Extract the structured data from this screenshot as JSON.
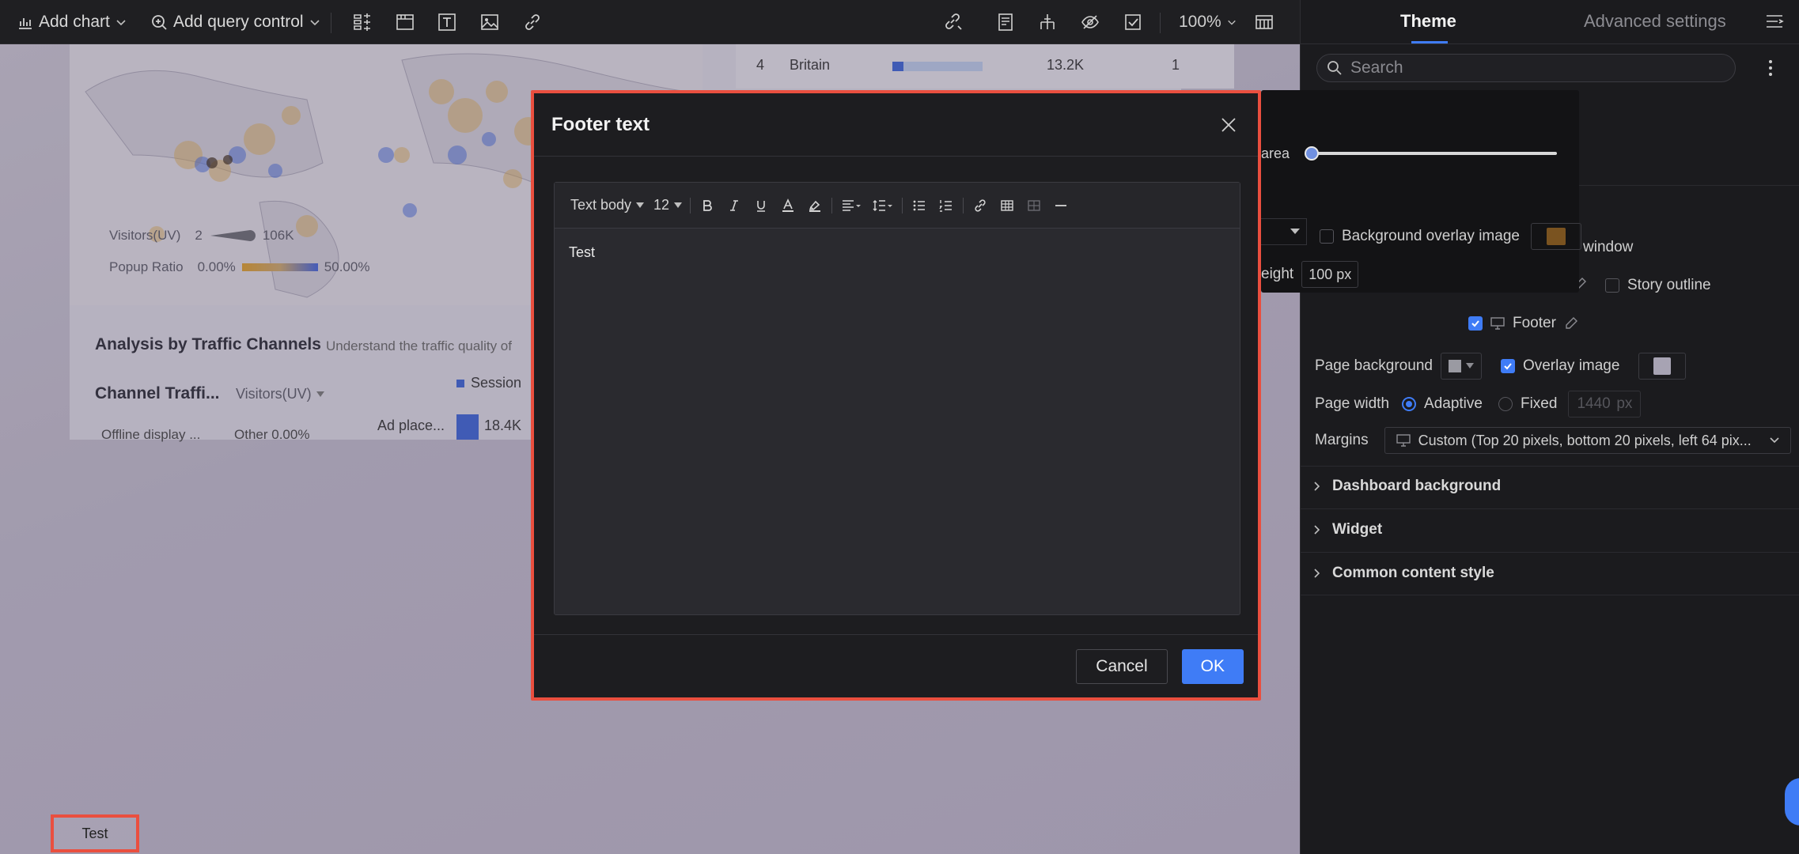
{
  "toolbar": {
    "add_chart": "Add chart",
    "add_query_control": "Add query control",
    "zoom": "100%"
  },
  "dashboard": {
    "ranking_row": {
      "rank": "4",
      "country": "Britain",
      "value": "13.2K",
      "trailing": "1",
      "share": 0.12
    },
    "map_legend": {
      "visitors_label": "Visitors(UV)",
      "visitors_min": "2",
      "visitors_max": "106K",
      "popup_label": "Popup Ratio",
      "popup_min": "0.00%",
      "popup_max": "50.00%"
    },
    "section_title": "Analysis by Traffic Channels",
    "section_subtitle": "Understand the traffic quality of",
    "channel_title": "Channel Traffi...",
    "channel_metric": "Visitors(UV)",
    "session_legend": "Session",
    "ad_place_label": "Ad place...",
    "ad_place_value": "18.4K",
    "offline_label": "Offline display ...",
    "other_label": "Other 0.00%"
  },
  "modal": {
    "title": "Footer text",
    "toolbar": {
      "style": "Text body",
      "size": "12"
    },
    "content": "Test",
    "cancel": "Cancel",
    "ok": "OK"
  },
  "footer_preview": "Test",
  "panel": {
    "tabs": [
      "Theme",
      "Advanced settings"
    ],
    "search_placeholder": "Search",
    "popup": {
      "area_label": "area",
      "bg_overlay": "Background overlay image",
      "height_label": "eight",
      "height_value": "100",
      "height_unit": "px",
      "swatch_color": "#7a5320"
    },
    "window_label": "window",
    "story_outline": "Story outline",
    "footer": "Footer",
    "page_background": "Page background",
    "overlay_image": "Overlay image",
    "page_width": "Page width",
    "adaptive": "Adaptive",
    "fixed": "Fixed",
    "fixed_value": "1440",
    "fixed_unit": "px",
    "margins": "Margins",
    "margins_value": "Custom (Top 20 pixels, bottom 20 pixels, left 64 pix...",
    "sections": [
      "Dashboard background",
      "Widget",
      "Common content style"
    ]
  }
}
